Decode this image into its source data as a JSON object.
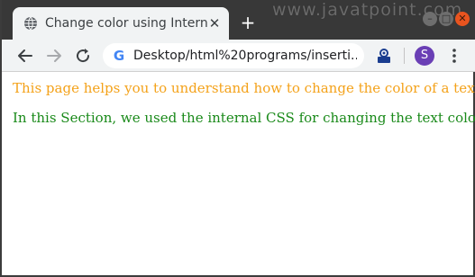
{
  "tab": {
    "title": "Change color using Intern",
    "icon": "globe-icon",
    "close_icon": "close-icon"
  },
  "new_tab_icon": "plus-icon",
  "watermark": "www.javatpoint.com",
  "window_controls": [
    "minimize-icon",
    "maximize-icon",
    "close-icon"
  ],
  "toolbar": {
    "back_icon": "arrow-left-icon",
    "forward_icon": "arrow-right-icon",
    "reload_icon": "reload-icon",
    "site_icon": "google-g-icon",
    "url": "Desktop/html%20programs/inserti..."
  },
  "profile": {
    "initial": "S",
    "color": "#6a3fb5"
  },
  "content": {
    "line1": "This page helps you to understand how to change the color of a text.",
    "line1_color": "#f4a21a",
    "line2": "In this Section, we used the internal CSS for changing the text color.",
    "line2_color": "#1a8a1a"
  }
}
